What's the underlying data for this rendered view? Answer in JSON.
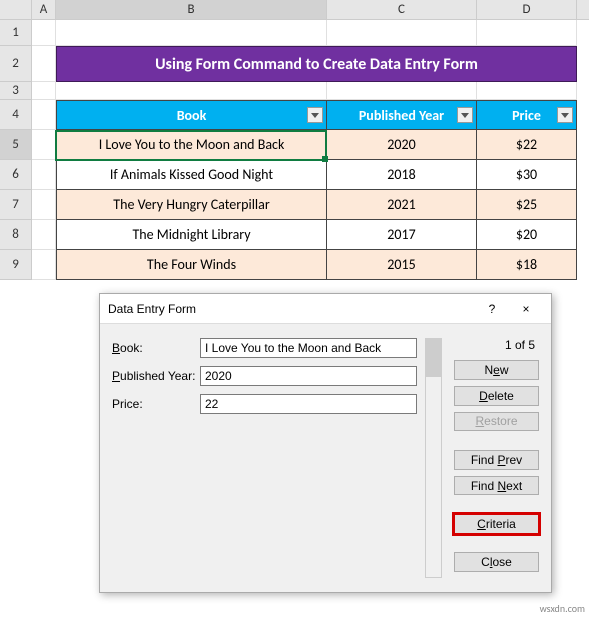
{
  "columns": [
    "A",
    "B",
    "C",
    "D"
  ],
  "rowNumbers": [
    "1",
    "2",
    "3",
    "4",
    "5",
    "6",
    "7",
    "8",
    "9"
  ],
  "title": "Using Form Command to Create Data Entry Form",
  "headers": {
    "book": "Book",
    "year": "Published Year",
    "price": "Price"
  },
  "rows": [
    {
      "book": "I Love You to the Moon and Back",
      "year": "2020",
      "price": "$22"
    },
    {
      "book": "If Animals Kissed Good Night",
      "year": "2018",
      "price": "$30"
    },
    {
      "book": "The Very Hungry Caterpillar",
      "year": "2021",
      "price": "$25"
    },
    {
      "book": "The Midnight Library",
      "year": "2017",
      "price": "$20"
    },
    {
      "book": "The Four Winds",
      "year": "2015",
      "price": "$18"
    }
  ],
  "dialog": {
    "title": "Data Entry Form",
    "help": "?",
    "close": "×",
    "labels": {
      "book_pre": "B",
      "book_rest": "ook:",
      "year_pre": "P",
      "year_rest": "ublished Year:",
      "price": "Price:"
    },
    "values": {
      "book": "I Love You to the Moon and Back",
      "year": "2020",
      "price": "22"
    },
    "counter": "1 of 5",
    "buttons": {
      "new_pre": "N",
      "new_u": "e",
      "new_post": "w",
      "delete_u": "D",
      "delete_post": "elete",
      "restore_u": "R",
      "restore_post": "estore",
      "findprev_pre": "Find ",
      "findprev_u": "P",
      "findprev_post": "rev",
      "findnext_pre": "Find ",
      "findnext_u": "N",
      "findnext_post": "ext",
      "criteria_u": "C",
      "criteria_post": "riteria",
      "close_pre": "C",
      "close_u": "l",
      "close_post": "ose"
    }
  },
  "watermark": "wsxdn.com"
}
